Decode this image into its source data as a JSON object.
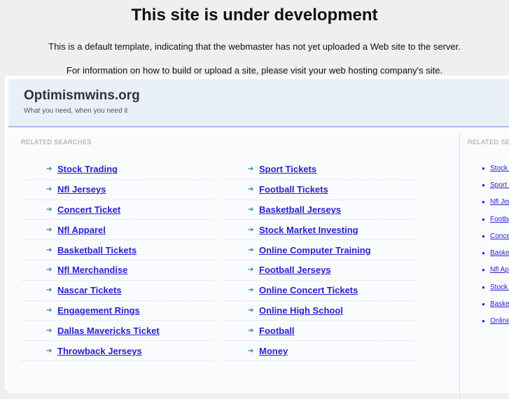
{
  "title": "This site is under development",
  "message1": "This is a default template, indicating that the webmaster has not yet uploaded a Web site to the server.",
  "message2": "For information on how to build or upload a site, please visit your web hosting company's site.",
  "site": {
    "name": "Optimismwins.org",
    "tagline": "What you need, when you need it"
  },
  "related_label": "RELATED SEARCHES",
  "left_col": [
    "Stock Trading",
    "Nfl Jerseys",
    "Concert Ticket",
    "Nfl Apparel",
    "Basketball Tickets",
    "Nfl Merchandise",
    "Nascar Tickets",
    "Engagement Rings",
    "Dallas Mavericks Ticket",
    "Throwback Jerseys"
  ],
  "right_col": [
    "Sport Tickets",
    "Football Tickets",
    "Basketball Jerseys",
    "Stock Market Investing",
    "Online Computer Training",
    "Football Jerseys",
    "Online Concert Tickets",
    "Online High School",
    "Football",
    "Money"
  ],
  "sidebar": {
    "label": "RELATED SEARCHES",
    "items": [
      "Stock Trading",
      "Sport Tickets",
      "Nfl Jerseys",
      "Football Tickets",
      "Concert Ticket",
      "Basketball Jerseys",
      "Nfl Apparel",
      "Stock Market Investing",
      "Basketball Tickets",
      "Online Computer Training"
    ]
  }
}
